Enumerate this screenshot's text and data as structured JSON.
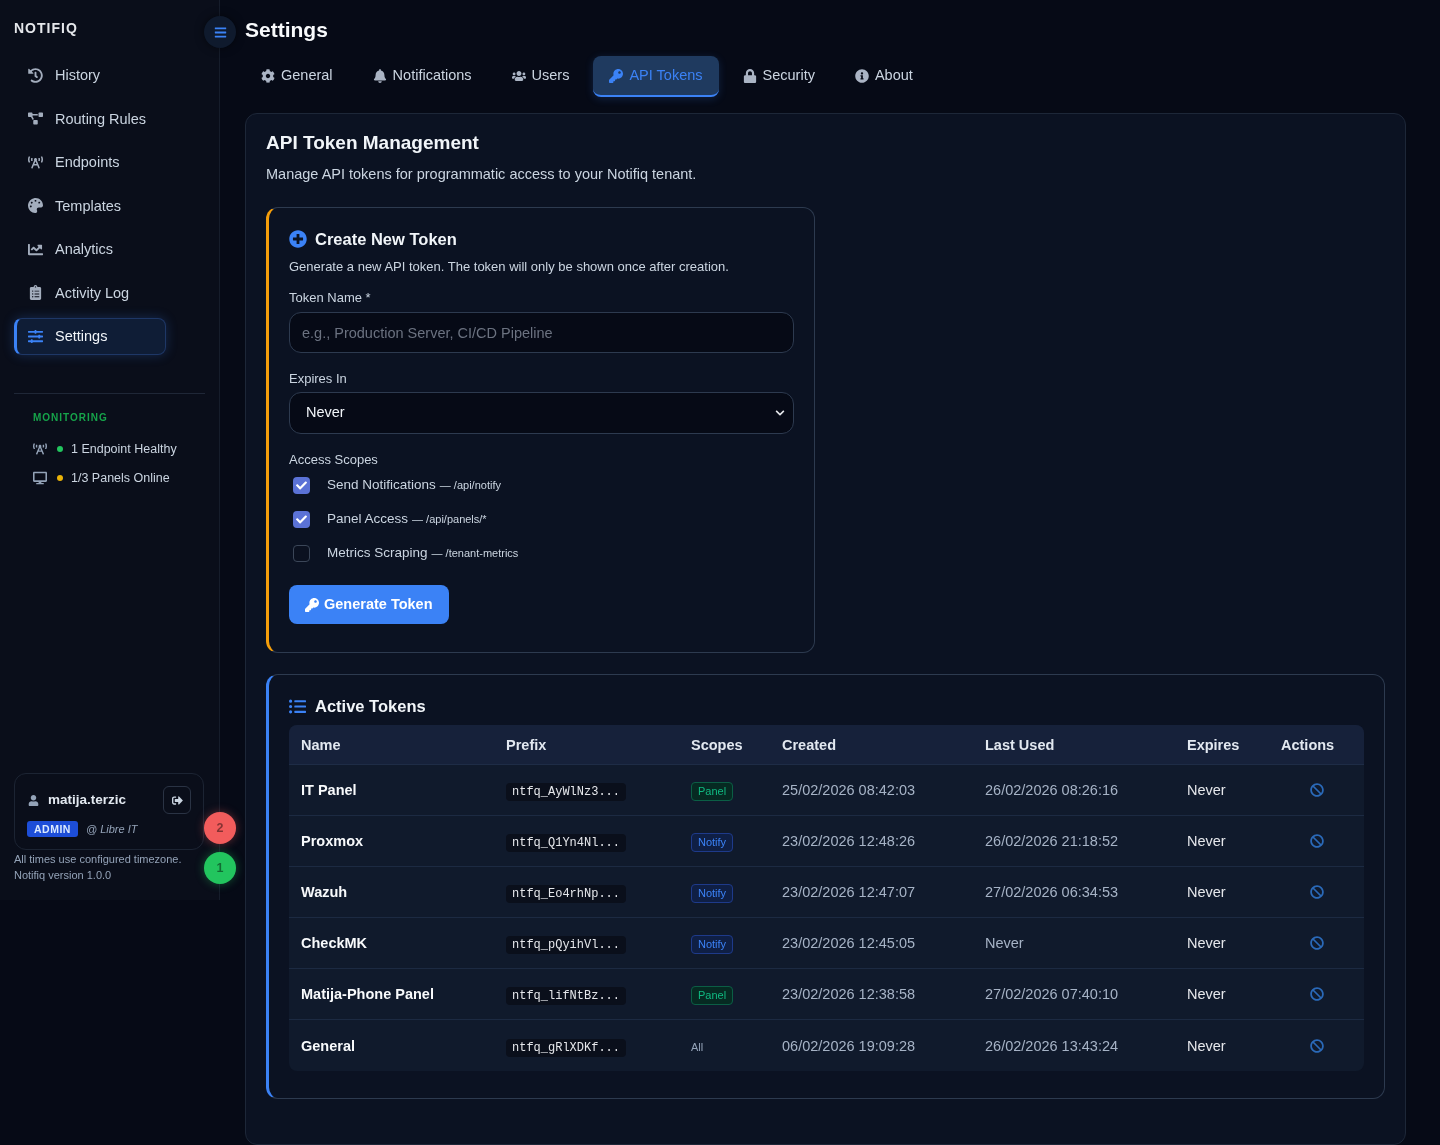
{
  "sidebar": {
    "brand": "NOTIFIQ",
    "items": [
      {
        "label": "History",
        "selected": false
      },
      {
        "label": "Routing Rules",
        "selected": false
      },
      {
        "label": "Endpoints",
        "selected": false
      },
      {
        "label": "Templates",
        "selected": false
      },
      {
        "label": "Analytics",
        "selected": false
      },
      {
        "label": "Activity Log",
        "selected": false
      },
      {
        "label": "Settings",
        "selected": true
      }
    ],
    "monitoring": {
      "title": "MONITORING",
      "items": [
        {
          "text": "1 Endpoint Healthy",
          "color": "#22c55e"
        },
        {
          "text": "1/3 Panels Online",
          "color": "#eab308"
        }
      ]
    },
    "user": {
      "name": "matija.terzic",
      "role": "ADMIN",
      "org": "@ Libre IT"
    },
    "footer": [
      "All times use configured timezone.",
      "Notifiq version 1.0.0"
    ]
  },
  "floating_badges": [
    {
      "count": "2",
      "color": "#f25c5c"
    },
    {
      "count": "1",
      "color": "#22c55e"
    }
  ],
  "page_title": "Settings",
  "tabs": [
    {
      "label": "General",
      "selected": false
    },
    {
      "label": "Notifications",
      "selected": false
    },
    {
      "label": "Users",
      "selected": false
    },
    {
      "label": "API Tokens",
      "selected": true
    },
    {
      "label": "Security",
      "selected": false
    },
    {
      "label": "About",
      "selected": false
    }
  ],
  "panel": {
    "title": "API Token Management",
    "subtitle": "Manage API tokens for programmatic access to your Notifiq tenant.",
    "create_token": {
      "title": "Create New Token",
      "description": "Generate a new API token. The token will only be shown once after creation.",
      "token_name": {
        "label": "Token Name *",
        "placeholder": "e.g., Production Server, CI/CD Pipeline"
      },
      "expires_in": {
        "label": "Expires In",
        "value": "Never"
      },
      "scopes": {
        "label": "Access Scopes",
        "items": [
          {
            "name": "Send Notifications",
            "path": "— /api/notify",
            "checked": true
          },
          {
            "name": "Panel Access",
            "path": "— /api/panels/*",
            "checked": true
          },
          {
            "name": "Metrics Scraping",
            "path": "— /tenant-metrics",
            "checked": false
          }
        ]
      },
      "button": "Generate Token"
    },
    "active_tokens": {
      "title": "Active Tokens",
      "columns": [
        "Name",
        "Prefix",
        "Scopes",
        "Created",
        "Last Used",
        "Expires",
        "Actions"
      ],
      "rows": [
        {
          "name": "IT Panel",
          "prefix": "ntfq_AyWlNz3...",
          "scope": {
            "label": "Panel",
            "kind": "panel"
          },
          "created": "25/02/2026 08:42:03",
          "last_used": "26/02/2026 08:26:16",
          "expires": "Never"
        },
        {
          "name": "Proxmox",
          "prefix": "ntfq_Q1Yn4Nl...",
          "scope": {
            "label": "Notify",
            "kind": "notify"
          },
          "created": "23/02/2026 12:48:26",
          "last_used": "26/02/2026 21:18:52",
          "expires": "Never"
        },
        {
          "name": "Wazuh",
          "prefix": "ntfq_Eo4rhNp...",
          "scope": {
            "label": "Notify",
            "kind": "notify"
          },
          "created": "23/02/2026 12:47:07",
          "last_used": "27/02/2026 06:34:53",
          "expires": "Never"
        },
        {
          "name": "CheckMK",
          "prefix": "ntfq_pQyihVl...",
          "scope": {
            "label": "Notify",
            "kind": "notify"
          },
          "created": "23/02/2026 12:45:05",
          "last_used": "Never",
          "expires": "Never"
        },
        {
          "name": "Matija-Phone Panel",
          "prefix": "ntfq_lifNtBz...",
          "scope": {
            "label": "Panel",
            "kind": "panel"
          },
          "created": "23/02/2026 12:38:58",
          "last_used": "27/02/2026 07:40:10",
          "expires": "Never"
        },
        {
          "name": "General",
          "prefix": "ntfq_gRlXDKf...",
          "scope": {
            "label": "All",
            "kind": "all"
          },
          "created": "06/02/2026 19:09:28",
          "last_used": "26/02/2026 13:43:24",
          "expires": "Never"
        }
      ]
    }
  }
}
